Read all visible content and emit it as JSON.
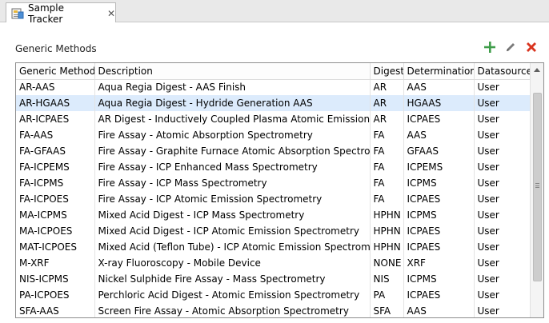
{
  "tab": {
    "label": "Sample Tracker",
    "close": "✕"
  },
  "section": {
    "title": "Generic Methods"
  },
  "toolbar": {
    "add": "add",
    "edit": "edit",
    "delete": "delete"
  },
  "colors": {
    "add": "#3f9d4a",
    "delete": "#d9341f",
    "selected_row": "#dcebfc"
  },
  "table": {
    "headers": [
      "Generic Method",
      "Description",
      "Digest",
      "Determination",
      "Datasource"
    ],
    "rows": [
      [
        "AR-AAS",
        "Aqua Regia Digest - AAS Finish",
        "AR",
        "AAS",
        "User"
      ],
      [
        "AR-HGAAS",
        "Aqua Regia Digest - Hydride Generation AAS",
        "AR",
        "HGAAS",
        "User"
      ],
      [
        "AR-ICPAES",
        "AR Digest - Inductively Coupled Plasma Atomic Emission",
        "AR",
        "ICPAES",
        "User"
      ],
      [
        "FA-AAS",
        "Fire Assay - Atomic Absorption Spectrometry",
        "FA",
        "AAS",
        "User"
      ],
      [
        "FA-GFAAS",
        "Fire Assay - Graphite Furnace Atomic Absorption Spectrometry",
        "FA",
        "GFAAS",
        "User"
      ],
      [
        "FA-ICPEMS",
        "Fire Assay - ICP Enhanced Mass Spectrometry",
        "FA",
        "ICPEMS",
        "User"
      ],
      [
        "FA-ICPMS",
        "Fire Assay - ICP Mass Spectrometry",
        "FA",
        "ICPMS",
        "User"
      ],
      [
        "FA-ICPOES",
        "Fire Assay - ICP Atomic Emission Spectrometry",
        "FA",
        "ICPAES",
        "User"
      ],
      [
        "MA-ICPMS",
        "Mixed Acid Digest - ICP Mass Spectrometry",
        "HPHN",
        "ICPMS",
        "User"
      ],
      [
        "MA-ICPOES",
        "Mixed Acid Digest - ICP Atomic Emission Spectrometry",
        "HPHN",
        "ICPAES",
        "User"
      ],
      [
        "MAT-ICPOES",
        "Mixed Acid (Teflon Tube) - ICP Atomic Emission Spectrometry",
        "HPHN",
        "ICPAES",
        "User"
      ],
      [
        "M-XRF",
        "X-ray Fluoroscopy - Mobile Device",
        "NONE",
        "XRF",
        "User"
      ],
      [
        "NIS-ICPMS",
        "Nickel Sulphide Fire Assay - Mass Spectrometry",
        "NIS",
        "ICPMS",
        "User"
      ],
      [
        "PA-ICPOES",
        "Perchloric Acid Digest - Atomic Emission Spectrometry",
        "PA",
        "ICPAES",
        "User"
      ],
      [
        "SFA-AAS",
        "Screen Fire Assay - Atomic Absorption Spectrometry",
        "SFA",
        "AAS",
        "User"
      ]
    ],
    "selected_row": 1
  }
}
